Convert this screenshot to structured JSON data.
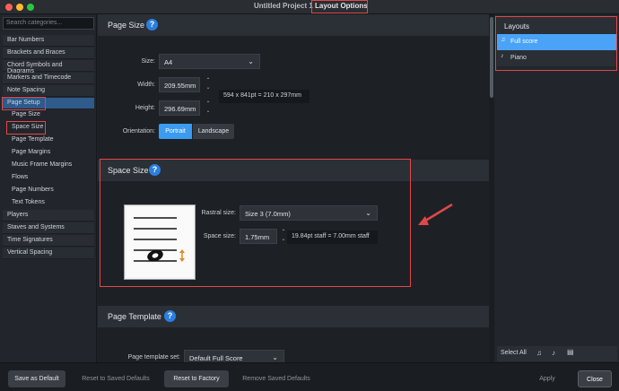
{
  "window": {
    "title_project": "Untitled Project 1",
    "title_dialog": "Layout Options",
    "traffic_colors": [
      "#ff5f57",
      "#febc2e",
      "#28c840"
    ]
  },
  "sidebar": {
    "search_placeholder": "Search categories...",
    "items": [
      {
        "label": "Bar Numbers"
      },
      {
        "label": "Brackets and Braces"
      },
      {
        "label": "Chord Symbols and Diagrams"
      },
      {
        "label": "Markers and Timecode"
      },
      {
        "label": "Note Spacing"
      },
      {
        "label": "Page Setup",
        "selected": true
      },
      {
        "label": "Page Size",
        "sub": true
      },
      {
        "label": "Space Size",
        "sub": true
      },
      {
        "label": "Page Template",
        "sub": true
      },
      {
        "label": "Page Margins",
        "sub": true
      },
      {
        "label": "Music Frame Margins",
        "sub": true
      },
      {
        "label": "Flows",
        "sub": true
      },
      {
        "label": "Page Numbers",
        "sub": true
      },
      {
        "label": "Text Tokens",
        "sub": true
      },
      {
        "label": "Players"
      },
      {
        "label": "Staves and Systems"
      },
      {
        "label": "Time Signatures"
      },
      {
        "label": "Vertical Spacing"
      }
    ]
  },
  "page_size": {
    "title": "Page Size",
    "help": "?",
    "size_label": "Size:",
    "size_value": "A4",
    "width_label": "Width:",
    "width_value": "209.55mm",
    "height_label": "Height:",
    "height_value": "296.69mm",
    "dimensions_info": "594 x 841pt = 210 x 297mm",
    "orientation_label": "Orientation:",
    "portrait": "Portrait",
    "landscape": "Landscape"
  },
  "space_size": {
    "title": "Space Size",
    "help": "?",
    "rastral_label": "Rastral size:",
    "rastral_value": "Size 3 (7.0mm)",
    "space_label": "Space size:",
    "space_value": "1.75mm",
    "staff_info": "19.84pt staff = 7.00mm staff"
  },
  "page_template": {
    "title": "Page Template",
    "help": "?",
    "set_label": "Page template set:",
    "set_value": "Default Full Score"
  },
  "layouts": {
    "header": "Layouts",
    "items": [
      {
        "label": "Full score",
        "selected": true,
        "icon": "full-score-icon"
      },
      {
        "label": "Piano",
        "selected": false,
        "icon": "part-icon"
      }
    ],
    "select_all": "Select All"
  },
  "footer": {
    "save_default": "Save as Default",
    "reset_saved": "Reset to Saved Defaults",
    "reset_factory": "Reset to Factory",
    "remove_saved": "Remove Saved Defaults",
    "apply": "Apply",
    "close": "Close"
  },
  "colors": {
    "accent": "#2a7fe0",
    "selection": "#4aa3f7",
    "highlight": "#e04848"
  }
}
